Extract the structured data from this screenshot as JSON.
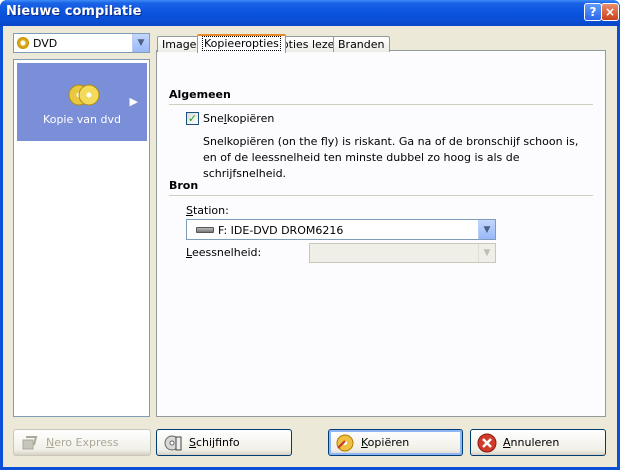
{
  "window": {
    "title": "Nieuwe compilatie",
    "help_label": "?",
    "close_label": "×"
  },
  "left": {
    "media_combo": {
      "value": "DVD"
    },
    "list_items": [
      {
        "label": "Kopie van dvd",
        "selected": true
      }
    ]
  },
  "tabs": [
    {
      "label": "Image",
      "active": false
    },
    {
      "label": "Kopieeropties",
      "active": true
    },
    {
      "label": "Opties lezen",
      "active": false
    },
    {
      "label": "Branden",
      "active": false
    }
  ],
  "panel": {
    "general": {
      "title": "Algemeen",
      "checkbox_label_pre": "Sne",
      "checkbox_label_u": "l",
      "checkbox_label_post": "kopiëren",
      "checkbox_checked": true,
      "note": "Snelkopiëren (on the fly) is riskant. Ga na of de bronschijf schoon is, en of de leessnelheid ten minste dubbel zo hoog is als de schrijfsnelheid."
    },
    "source": {
      "title": "Bron",
      "station_label_u": "S",
      "station_label_post": "tation:",
      "station_value": "F: IDE-DVD DROM6216",
      "speed_label_u": "L",
      "speed_label_post": "eessnelheid:",
      "speed_value": ""
    }
  },
  "buttons": {
    "nero_express": {
      "u": "N",
      "rest": "ero Express",
      "enabled": false
    },
    "disc_info": {
      "u": "S",
      "rest": "chijfinfo",
      "enabled": true
    },
    "copy": {
      "u": "K",
      "rest": "opiëren",
      "enabled": true
    },
    "cancel": {
      "u": "A",
      "rest": "nnuleren",
      "enabled": true
    }
  },
  "colors": {
    "titlebar": "#0a4fd6",
    "client": "#ece9d8",
    "selection": "#7b8fd8",
    "tab_highlight": "#e68b2c"
  }
}
